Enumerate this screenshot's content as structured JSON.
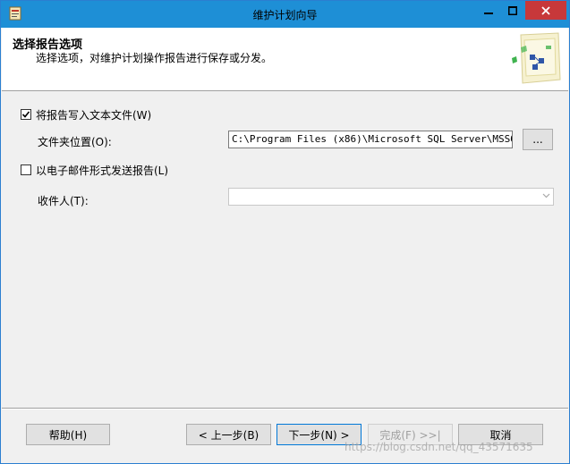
{
  "window": {
    "title": "维护计划向导"
  },
  "header": {
    "title": "选择报告选项",
    "subtitle": "选择选项，对维护计划操作报告进行保存或分发。"
  },
  "options": {
    "write_text_file": {
      "label": "将报告写入文本文件(W)",
      "checked": true
    },
    "folder_location": {
      "label": "文件夹位置(O):",
      "value": "C:\\Program Files (x86)\\Microsoft SQL Server\\MSSQL10.",
      "browse_label": "..."
    },
    "email_report": {
      "label": "以电子邮件形式发送报告(L)",
      "checked": false
    },
    "recipient": {
      "label": "收件人(T):",
      "value": ""
    }
  },
  "footer": {
    "help_label": "帮助(H)",
    "back_label": "< 上一步(B)",
    "next_label": "下一步(N) >",
    "finish_label": "完成(F) >>|",
    "cancel_label": "取消"
  },
  "watermark": "https://blog.csdn.net/qq_43571635",
  "colors": {
    "titlebar": "#1e8fd6",
    "close": "#c7383a",
    "focus": "#0078d7"
  },
  "icons": [
    "app-icon",
    "minimize-icon",
    "maximize-icon",
    "close-icon",
    "wizard-illustration-icon",
    "checkmark-icon",
    "chevron-down-icon"
  ]
}
